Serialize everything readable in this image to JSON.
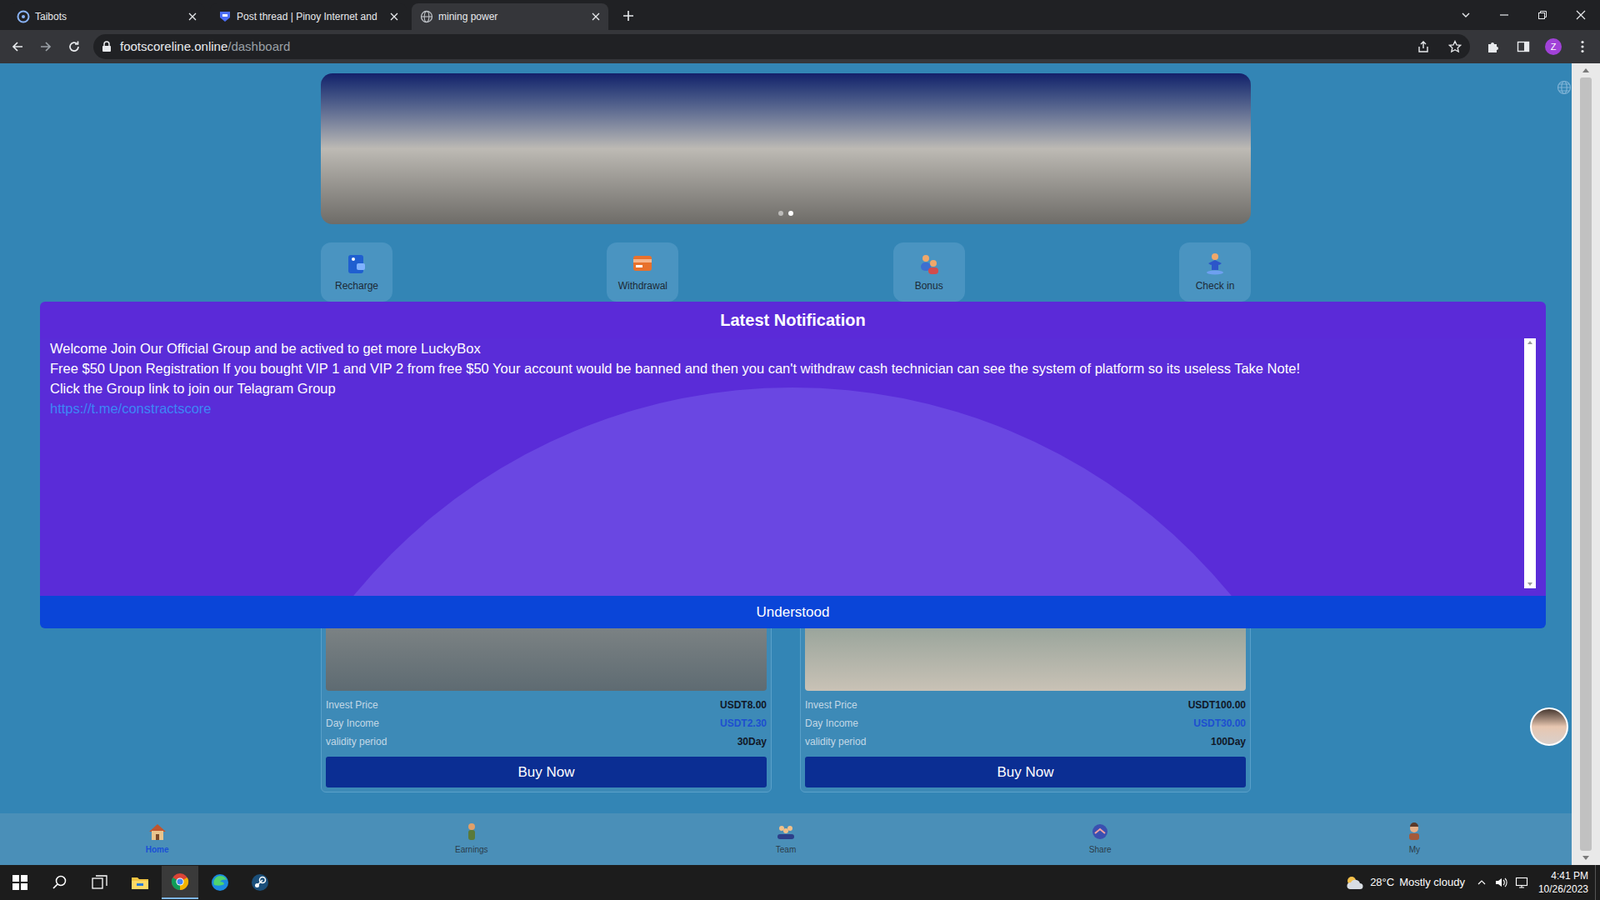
{
  "browser": {
    "tabs": [
      {
        "label": "Taibots",
        "selected": false
      },
      {
        "label": "Post thread | Pinoy Internet and",
        "selected": false
      },
      {
        "label": "mining power",
        "selected": true
      }
    ],
    "address": {
      "host": "footscoreline.online",
      "path": "/dashboard"
    },
    "profile": "Z"
  },
  "page": {
    "slides": [
      {
        "selected": false
      },
      {
        "selected": true
      }
    ],
    "actions": [
      "Recharge",
      "Withdrawal",
      "Bonus",
      "Check in"
    ],
    "products": [
      {
        "rows": [
          {
            "label": "Invest Price",
            "value": "USDT8.00",
            "kind": "plain"
          },
          {
            "label": "Day Income",
            "value": "USDT2.30",
            "kind": "income"
          },
          {
            "label": "validity period",
            "value": "30Day",
            "kind": "plain"
          }
        ],
        "button": "Buy Now"
      },
      {
        "rows": [
          {
            "label": "Invest Price",
            "value": "USDT100.00",
            "kind": "plain"
          },
          {
            "label": "Day Income",
            "value": "USDT30.00",
            "kind": "income"
          },
          {
            "label": "validity period",
            "value": "100Day",
            "kind": "plain"
          }
        ],
        "button": "Buy Now"
      }
    ],
    "nav": [
      {
        "label": "Home",
        "selected": true
      },
      {
        "label": "Earnings",
        "selected": false
      },
      {
        "label": "Team",
        "selected": false
      },
      {
        "label": "Share",
        "selected": false
      },
      {
        "label": "My",
        "selected": false
      }
    ]
  },
  "notification": {
    "title": "Latest Notification",
    "lines": [
      "Welcome Join Our Official Group and be actived to get more LuckyBox",
      "Free $50 Upon Registration If you bought VIP 1 and VIP 2 from free $50 Your account would be banned and then you can't withdraw cash technician can see the system of platform so its useless Take Note!",
      "Click the Group link to join our Telagram Group"
    ],
    "link": "https://t.me/constractscore",
    "button": "Understood"
  },
  "taskbar": {
    "temperature": "28°C",
    "weather": "Mostly cloudy",
    "time": "4:41 PM",
    "date": "10/26/2023"
  }
}
